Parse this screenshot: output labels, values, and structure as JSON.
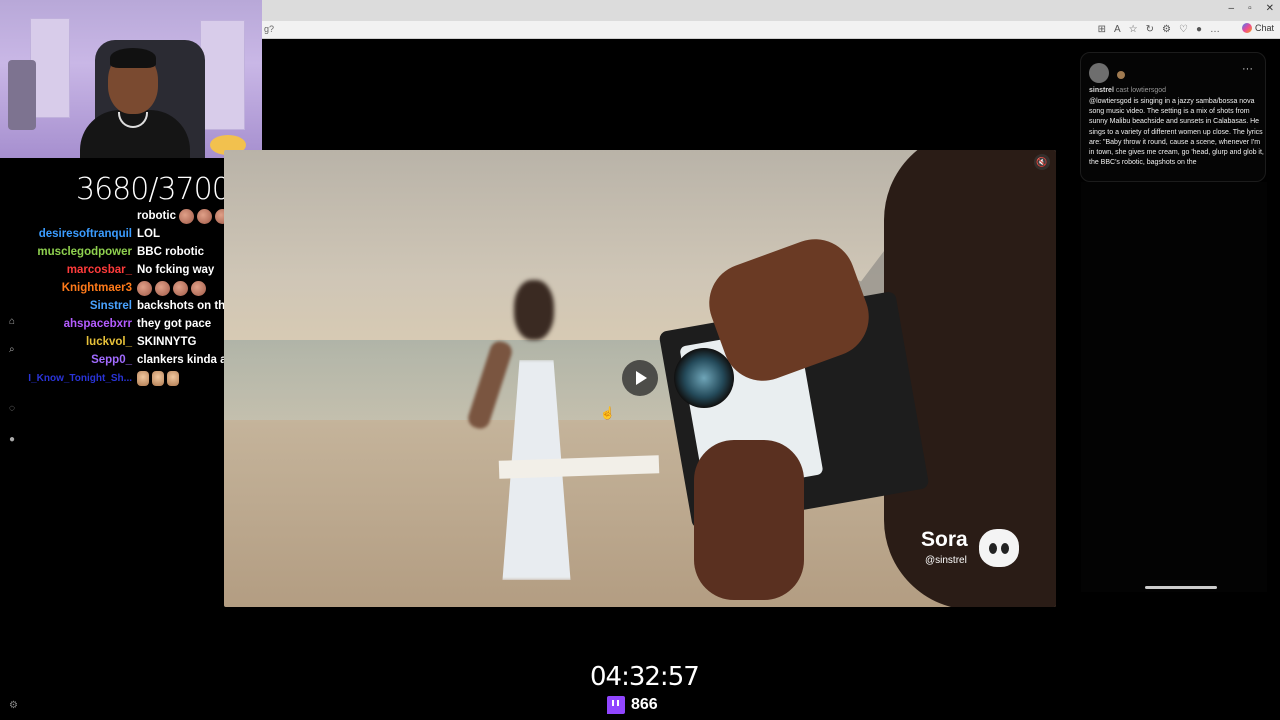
{
  "browser": {
    "address_text": "g?",
    "chat_label": "Chat",
    "window_controls": [
      "–",
      "▫",
      "✕"
    ]
  },
  "stream": {
    "goal": "3680/3700",
    "timer": "04:32:57",
    "viewer_count": "866"
  },
  "chat": [
    {
      "name": "",
      "name_color": "#ffffff",
      "message": "robotic",
      "emotes": 4,
      "emote_type": "face"
    },
    {
      "name": "desiresoftranquil",
      "name_color": "#3b9cff",
      "message": "LOL",
      "emotes": 0
    },
    {
      "name": "musclegodpower",
      "name_color": "#8fd14f",
      "message": "BBC robotic",
      "emotes": 0
    },
    {
      "name": "marcosbar_",
      "name_color": "#ff3b3b",
      "message": "No fcking way",
      "emotes": 0
    },
    {
      "name": "Knightmaer3",
      "name_color": "#ff7a1a",
      "message": "",
      "emotes": 4,
      "emote_type": "face"
    },
    {
      "name": "Sinstrel",
      "name_color": "#4aa3ff",
      "message": "backshots on the oceaaaan",
      "emotes": 0
    },
    {
      "name": "ahspacebxrr",
      "name_color": "#b45cff",
      "message": "they got pace",
      "emotes": 0
    },
    {
      "name": "luckvol_",
      "name_color": "#e8c23a",
      "message": "SKINNYTG",
      "emotes": 0
    },
    {
      "name": "Sepp0_",
      "name_color": "#a16bff",
      "message": "clankers kinda advanced nowadays",
      "emotes": 0
    },
    {
      "name": "I_Know_Tonight_Sh...",
      "name_color": "#2a34d8",
      "message": "",
      "emotes": 3,
      "emote_type": "hand"
    }
  ],
  "video": {
    "watermark": "Sora",
    "handle": "@sinstrel"
  },
  "post": {
    "username": "sinstrel",
    "cast_label": "cast lowtiersgod",
    "body": "@lowtiersgod is singing in a jazzy samba/bossa nova song music video. The setting is a mix of shots from sunny Malibu beachside and sunsets in Calabasas. He sings to a variety of different women up close. The lyrics are: \"Baby throw it round, cause a scene, whenever I'm in town, she gives me cream, go 'head, glurp and glob it, the BBC's robotic, bagshots on the",
    "more_label": "···"
  },
  "colors": {
    "twitch_purple": "#9146ff",
    "background": "#000000"
  }
}
